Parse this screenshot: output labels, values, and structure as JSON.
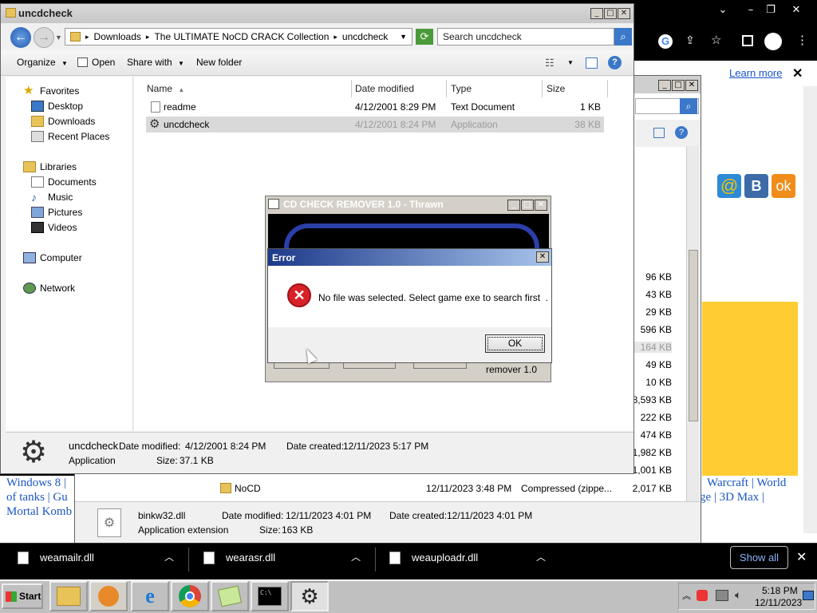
{
  "explorer": {
    "title": "uncdcheck",
    "breadcrumb": [
      "Downloads",
      "The ULTIMATE NoCD CRACK Collection",
      "uncdcheck"
    ],
    "search_placeholder": "Search uncdcheck",
    "toolbar": {
      "organize": "Organize",
      "open": "Open",
      "share_with": "Share with",
      "new_folder": "New folder"
    },
    "sidebar": {
      "favorites": "Favorites",
      "favorites_items": [
        "Desktop",
        "Downloads",
        "Recent Places"
      ],
      "libraries": "Libraries",
      "libraries_items": [
        "Documents",
        "Music",
        "Pictures",
        "Videos"
      ],
      "computer": "Computer",
      "network": "Network"
    },
    "columns": {
      "name": "Name",
      "date": "Date modified",
      "type": "Type",
      "size": "Size"
    },
    "files": [
      {
        "name": "readme",
        "date": "4/12/2001 8:29 PM",
        "type": "Text Document",
        "size": "1 KB"
      },
      {
        "name": "uncdcheck",
        "date": "4/12/2001 8:24 PM",
        "type": "Application",
        "size": "38 KB"
      }
    ],
    "details": {
      "name": "uncdcheck",
      "modified_label": "Date modified:",
      "modified": "4/12/2001 8:24 PM",
      "created_label": "Date created:",
      "created": "12/11/2023 5:17 PM",
      "type": "Application",
      "size_label": "Size:",
      "size": "37.1 KB"
    }
  },
  "back_explorer": {
    "sizes": [
      "96 KB",
      "43 KB",
      "29 KB",
      "596 KB",
      "164 KB",
      "49 KB",
      "10 KB",
      "18,593 KB",
      "222 KB",
      "474 KB",
      "1,982 KB",
      "1,001 KB"
    ],
    "nocd_row": {
      "name": "NoCD",
      "date": "12/11/2023 3:48 PM",
      "type": "Compressed (zippe...",
      "size": "2,017 KB"
    },
    "details": {
      "name": "binkw32.dll",
      "modified_label": "Date modified:",
      "modified": "12/11/2023 4:01 PM",
      "created_label": "Date created:",
      "created": "12/11/2023 4:01 PM",
      "type": "Application extension",
      "size_label": "Size:",
      "size": "163 KB"
    }
  },
  "chrome": {
    "learn_more": "Learn more",
    "page_text_left": [
      "Windows 8 |",
      "of tanks | Gu",
      "Mortal Komb"
    ],
    "page_text_right": [
      "Warcraft | World",
      "ge | 3D Max |"
    ],
    "downloads": [
      "weamailr.dll",
      "wearasr.dll",
      "weauploadr.dll"
    ],
    "show_all": "Show all"
  },
  "cd_remover": {
    "title": "CD CHECK REMOVER 1.0 - Thrawn",
    "footer": "remover 1.0"
  },
  "error_dialog": {
    "title": "Error",
    "message": "No file was selected. Select game exe to search first  .",
    "ok": "OK"
  },
  "taskbar": {
    "start": "Start",
    "time": "5:18 PM",
    "date": "12/11/2023"
  },
  "colors": {
    "taskbar": "#c0c0c0",
    "selection": "#d9d9d9",
    "error_title": "#1c3a8a",
    "link": "#1a55c4",
    "chrome_dark": "#000000"
  }
}
